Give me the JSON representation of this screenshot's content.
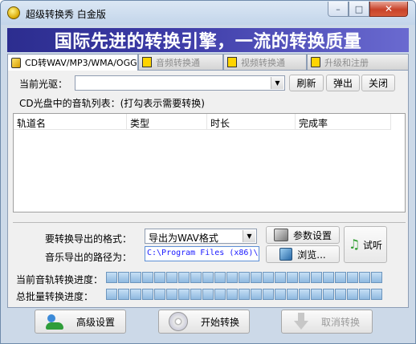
{
  "window": {
    "title": "超级转换秀 白金版"
  },
  "titlebar_buttons": {
    "minimize": "–",
    "maximize": "□",
    "close": "✕"
  },
  "banner": {
    "text": "国际先进的转换引擎，一流的转换质量"
  },
  "tabs": [
    {
      "label": "CD转WAV/MP3/WMA/OGG",
      "active": true,
      "icon": "cd-icon"
    },
    {
      "label": "音频转换通",
      "active": false,
      "icon": "audio-icon"
    },
    {
      "label": "视频转换通",
      "active": false,
      "icon": "video-icon"
    },
    {
      "label": "升级和注册",
      "active": false,
      "icon": "register-icon"
    }
  ],
  "drive": {
    "label": "当前光驱：",
    "value": "",
    "refresh": "刷新",
    "eject": "弹出",
    "close": "关闭"
  },
  "tracklist": {
    "caption": "CD光盘中的音轨列表：(打勾表示需要转换)",
    "columns": [
      "轨道名",
      "类型",
      "时长",
      "完成率"
    ]
  },
  "output": {
    "format_label": "要转换导出的格式：",
    "format_value": "导出为WAV格式",
    "path_label": "音乐导出的路径为：",
    "path_value": "C:\\Program Files (x86)\\",
    "settings_button": "参数设置",
    "browse_button": "浏览...",
    "preview_button": "试听"
  },
  "progress": {
    "track_label": "当前音轨转换进度：",
    "track_value": 0,
    "batch_label": "总批量转换进度：",
    "batch_value": 0
  },
  "actions": {
    "advanced": "高级设置",
    "start": "开始转换",
    "cancel": "取消转换"
  },
  "colors": {
    "banner_start": "#2c2d8f",
    "banner_end": "#6a6ad0",
    "progress_empty": "#a8cbeb",
    "path_text": "#1a1aff"
  }
}
